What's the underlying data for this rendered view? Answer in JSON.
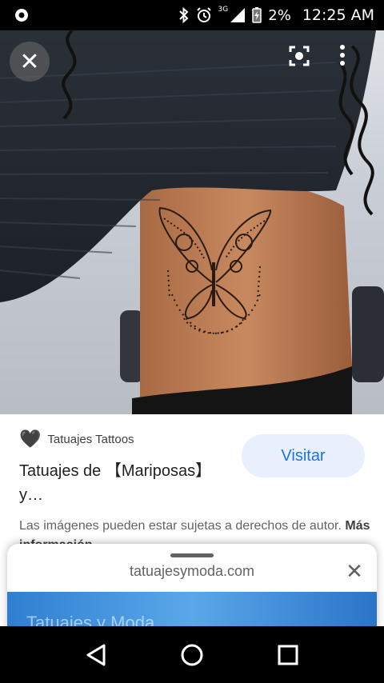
{
  "status_bar": {
    "network_label": "3G",
    "battery": "2%",
    "time": "12:25 AM"
  },
  "hero": {
    "close_label": "✕"
  },
  "result": {
    "source_name": "Tatuajes Tattoos",
    "source_icon": "black-heart-icon",
    "title": "Tatuajes de 【Mariposas】y…",
    "visit_label": "Visitar",
    "copyright_text": "Las imágenes pueden estar sujetas a derechos de autor.",
    "more_info_label": "Más información"
  },
  "sheet": {
    "url": "tatuajesymoda.com",
    "close_label": "✕",
    "banner_text": "Tatuajes y Moda"
  },
  "colors": {
    "accent": "#1a73e8",
    "visit_bg": "#e8f0fe",
    "banner": "#3b8ad8"
  }
}
